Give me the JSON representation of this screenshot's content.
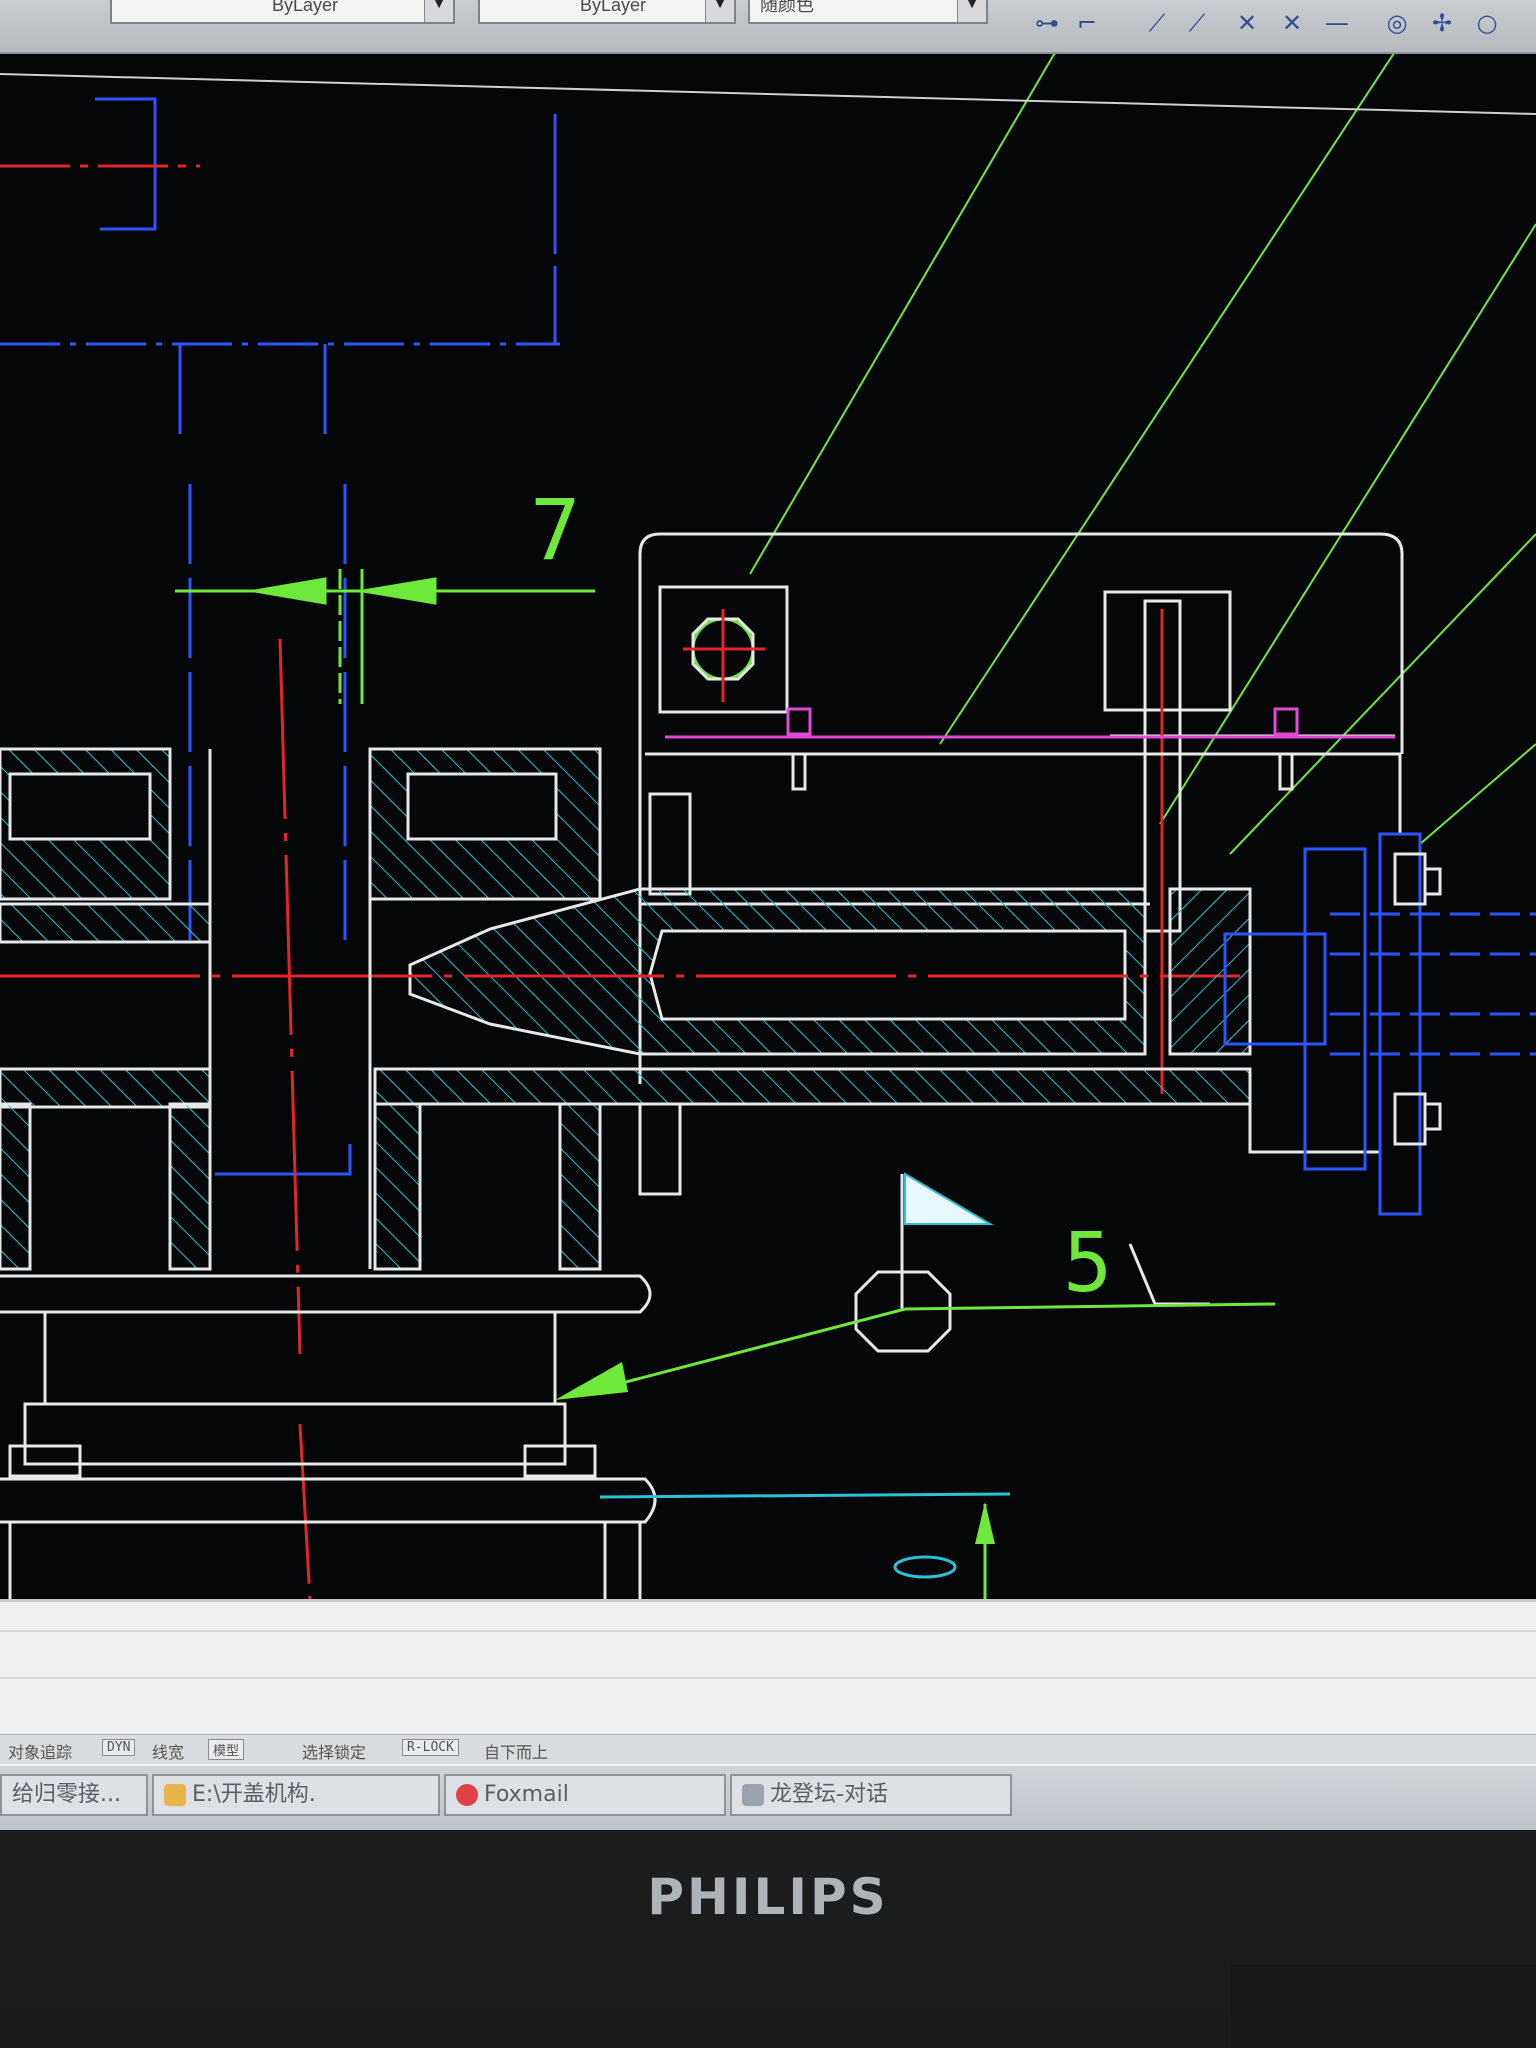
{
  "toolbar": {
    "linetype_value": "ByLayer",
    "lineweight_value": "ByLayer",
    "color_value": "随颜色",
    "icons": [
      "snap-icon",
      "line-icon",
      "xline-icon",
      "cross-icon",
      "extend-icon",
      "circle-icon",
      "orbit-icon",
      "circle-outline-icon"
    ]
  },
  "drawing": {
    "dimension_value": "7",
    "roughness_value": "5",
    "colors": {
      "background": "#050608",
      "outline": "#e8e8e8",
      "hatch": "#27c4d6",
      "centerline": "#e0262a",
      "dimension": "#6ee83a",
      "hidden": "#2a55ff",
      "fastener": "#e04ad6"
    }
  },
  "status": {
    "object_snap": "对象追踪",
    "dyn": "DYN",
    "lineweight": "线宽",
    "model": "模型",
    "selection_lock": "选择锁定",
    "r_lock": "R-LOCK",
    "top_to_bottom": "自下而上"
  },
  "taskbar": {
    "items": [
      {
        "label": "给归零接...",
        "icon": "folder-icon"
      },
      {
        "label": "E:\\开盖机构.",
        "icon": "folder-icon"
      },
      {
        "label": "Foxmail",
        "icon": "foxmail-icon"
      },
      {
        "label": "龙登坛-对话",
        "icon": "chat-icon"
      }
    ]
  },
  "monitor": {
    "brand": "PHILIPS"
  }
}
